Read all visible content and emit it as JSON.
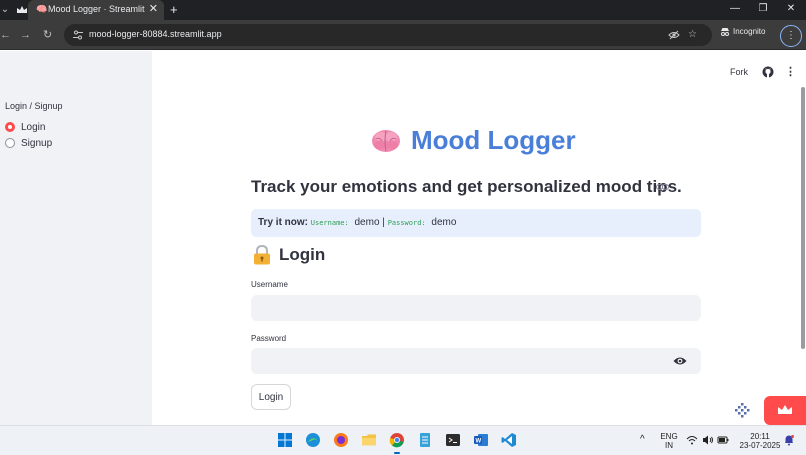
{
  "browser": {
    "tab_title": "Mood Logger · Streamlit",
    "tab_close": "✕",
    "new_tab": "+",
    "url": "mood-logger-80884.streamlit.app",
    "incognito_label": "Incognito",
    "window_minimize": "—",
    "window_restore": "❐",
    "window_close": "✕"
  },
  "sidebar": {
    "radio_label": "Login / Signup",
    "options": [
      {
        "label": "Login",
        "selected": true
      },
      {
        "label": "Signup",
        "selected": false
      }
    ]
  },
  "header": {
    "fork_label": "Fork",
    "menu_glyph": "⋮"
  },
  "main": {
    "title": "Mood Logger",
    "subheading": "Track your emotions and get personalized mood tips.",
    "info": {
      "prefix": "Try it now:",
      "username_label": "Username:",
      "username_value": "demo",
      "separator": "|",
      "password_label": "Password:",
      "password_value": "demo"
    },
    "login_heading": "Login",
    "username_label": "Username",
    "username_value": "",
    "password_label": "Password",
    "password_value": "",
    "login_button": "Login"
  },
  "taskbar": {
    "language_line1": "ENG",
    "language_line2": "IN",
    "time": "20:11",
    "date": "23-07-2025",
    "chevron": "^"
  },
  "colors": {
    "accent": "#ff4b4b",
    "title_blue": "#4a7fd9",
    "sidebar_bg": "#f0f2f6",
    "info_bg": "#e8effc",
    "code_green": "#2e9e55"
  }
}
